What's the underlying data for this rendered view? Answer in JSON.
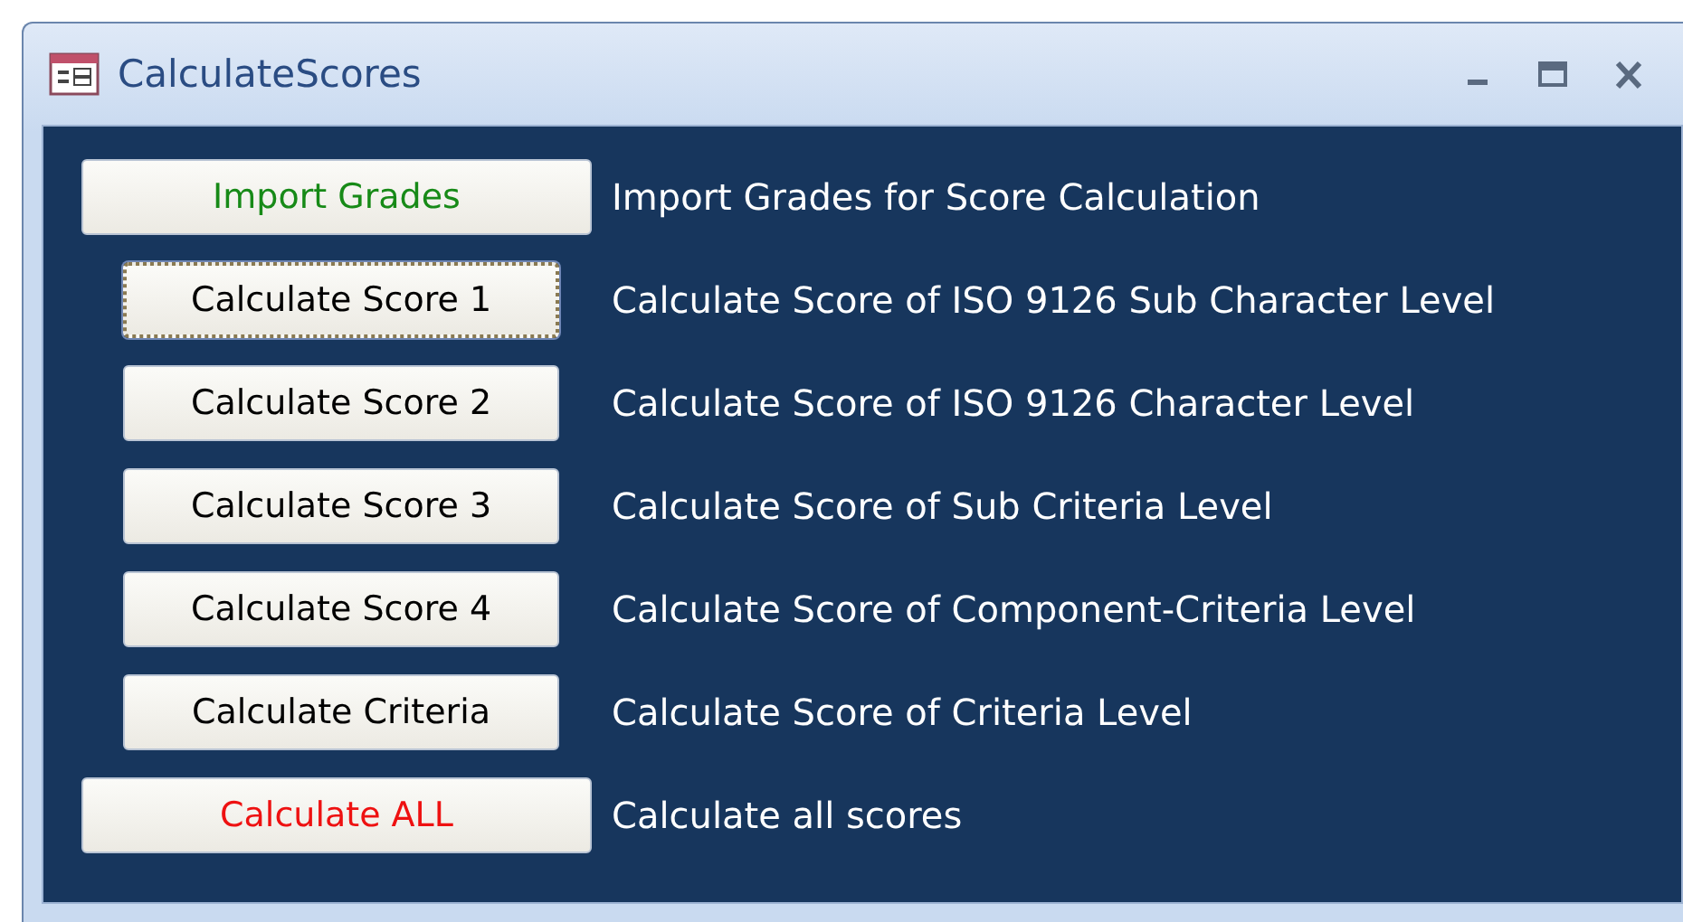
{
  "window": {
    "title": "CalculateScores"
  },
  "rows": [
    {
      "button": "Import Grades",
      "kind": "wide",
      "color": "#178a17",
      "focused": false,
      "description": "Import Grades for Score Calculation"
    },
    {
      "button": "Calculate Score 1",
      "kind": "narrow",
      "color": "#000000",
      "focused": true,
      "description": "Calculate Score of ISO 9126 Sub Character Level"
    },
    {
      "button": "Calculate Score 2",
      "kind": "narrow",
      "color": "#000000",
      "focused": false,
      "description": "Calculate Score of ISO 9126 Character Level"
    },
    {
      "button": "Calculate Score 3",
      "kind": "narrow",
      "color": "#000000",
      "focused": false,
      "description": "Calculate Score of Sub Criteria Level"
    },
    {
      "button": "Calculate Score 4",
      "kind": "narrow",
      "color": "#000000",
      "focused": false,
      "description": "Calculate Score of Component-Criteria Level"
    },
    {
      "button": "Calculate Criteria",
      "kind": "narrow",
      "color": "#000000",
      "focused": false,
      "description": "Calculate Score of Criteria Level"
    },
    {
      "button": "Calculate ALL",
      "kind": "wide",
      "color": "#ee1111",
      "focused": false,
      "description": "Calculate all scores"
    }
  ]
}
